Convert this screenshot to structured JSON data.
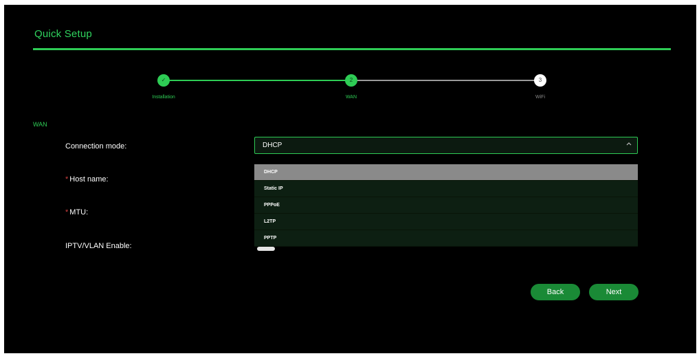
{
  "header": {
    "title": "Quick Setup"
  },
  "stepper": {
    "steps": [
      {
        "marker": "✓",
        "label": "Installation"
      },
      {
        "marker": "2",
        "label": "WAN"
      },
      {
        "marker": "3",
        "label": "WiFi"
      }
    ]
  },
  "section": {
    "label": "WAN"
  },
  "form": {
    "connection_mode_label": "Connection mode:",
    "host_name_label": "Host name:",
    "mtu_label": "MTU:",
    "iptv_label": "IPTV/VLAN Enable:",
    "required_marker": "*",
    "connection_mode_value": "DHCP"
  },
  "dropdown": {
    "options": [
      "DHCP",
      "Static IP",
      "PPPoE",
      "L2TP",
      "PPTP"
    ],
    "selected": "DHCP"
  },
  "buttons": {
    "back": "Back",
    "next": "Next"
  },
  "colors": {
    "accent": "#2ecc55",
    "background": "#000000",
    "button": "#1a8a36",
    "selected_option": "#8a8a8a"
  }
}
